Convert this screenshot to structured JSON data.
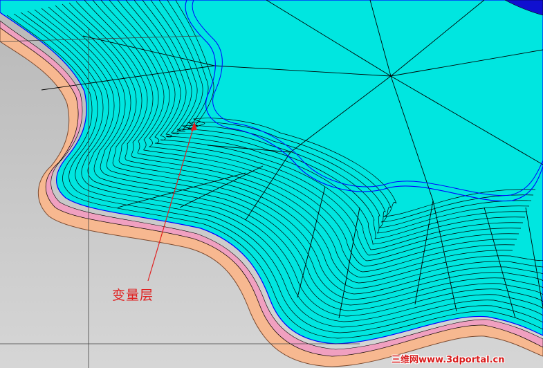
{
  "viewport": {
    "annotation": {
      "label": "变量层"
    },
    "watermark": {
      "text": "三维网www.3dportal.cn"
    }
  },
  "colors": {
    "background": "#c4c4c4",
    "surface_fill": "#00e6e0",
    "contour_stroke": "#000000",
    "outer_edge": "#0000ff",
    "base_layer": "#f7b890",
    "base_layer_pink": "#f0a0c0",
    "annotation": "#e02020"
  }
}
